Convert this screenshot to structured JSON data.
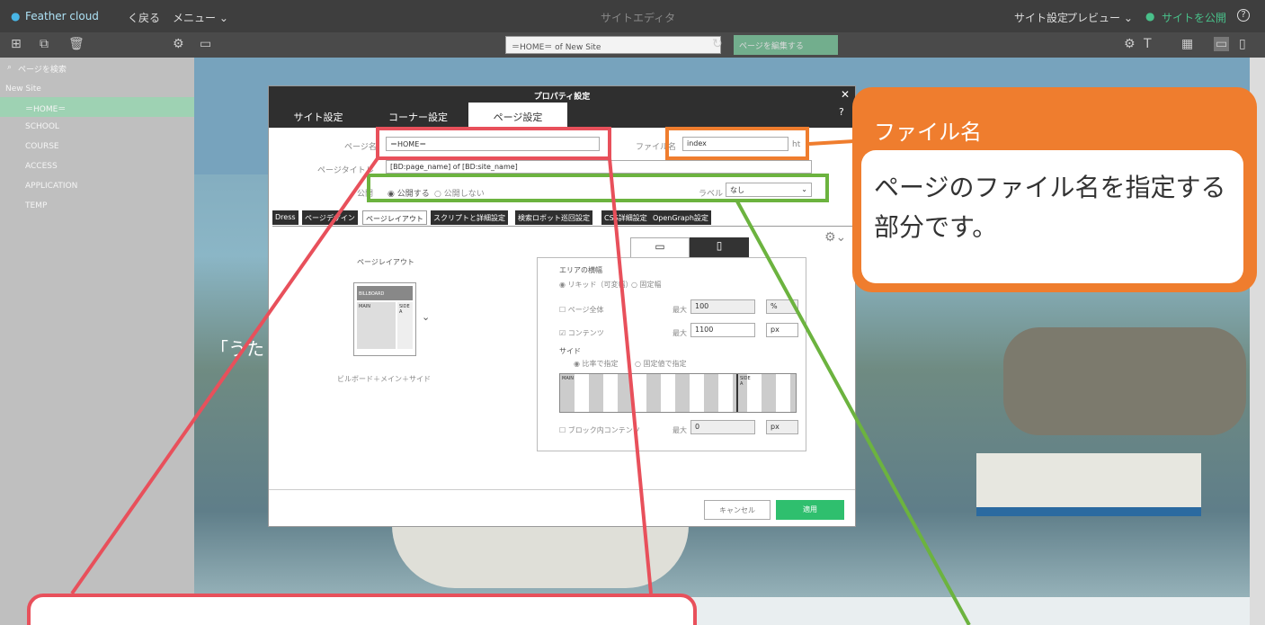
{
  "topbar": {
    "logo": "Feather cloud",
    "back": "く戻る",
    "menu": "メニュー ⌄",
    "center": "サイトエディタ",
    "site_settings": "サイト設定",
    "preview": "プレビュー ⌄",
    "publish": "サイトを公開",
    "help": "?"
  },
  "toolbar": {
    "url": "＝HOME＝ of New Site",
    "edit": "ページを編集する"
  },
  "sidebar": {
    "search_placeholder": "ページを検索",
    "site": "New Site",
    "pages": [
      "＝HOME＝",
      "SCHOOL",
      "COURSE",
      "ACCESS",
      "APPLICATION",
      "TEMP"
    ]
  },
  "dialog": {
    "title": "プロパティ設定",
    "tabs": [
      "サイト設定",
      "コーナー設定",
      "ページ設定"
    ],
    "page_name_label": "ページ名",
    "page_name": "＝HOME＝",
    "file_name_label": "ファイル名",
    "file_name": "index",
    "file_ext": "ht",
    "page_title_label": "ページタイトル",
    "page_title": "[BD:page_name] of [BD:site_name]",
    "publish_label": "公開",
    "publish_yes": "公開する",
    "publish_no": "公開しない",
    "label_label": "ラベル",
    "label_value": "なし",
    "subtabs": [
      "Dress",
      "ページデザイン",
      "ページレイアウト",
      "スクリプトと詳細設定",
      "検索ロボット巡回設定",
      "CSS詳細設定",
      "OpenGraph設定"
    ],
    "layout_title": "ページレイアウト",
    "layout_caption": "ビルボード＋メイン＋サイド",
    "thumb_billboard": "BILLBOARD",
    "thumb_main": "MAIN",
    "thumb_side": "SIDE A",
    "area_width": "エリアの横幅",
    "liquid": "リキッド（可変幅）",
    "fixed": "固定幅",
    "page_all": "ページ全体",
    "max": "最大",
    "page_all_val": "100",
    "page_all_unit": "%",
    "contents": "コンテンツ",
    "contents_val": "1100",
    "contents_unit": "px",
    "side": "サイド",
    "ratio": "比率で指定",
    "fixed_side": "固定値で指定",
    "bar_main": "MAIN",
    "bar_side": "SIDE A",
    "block_contents": "ブロック内コンテンツ",
    "block_val": "0",
    "block_unit": "px",
    "cancel": "キャンセル",
    "apply": "適用"
  },
  "preview_text": "「うた",
  "callout": {
    "title": "ファイル名",
    "body": "ページのファイル名を指定する部分です。"
  }
}
